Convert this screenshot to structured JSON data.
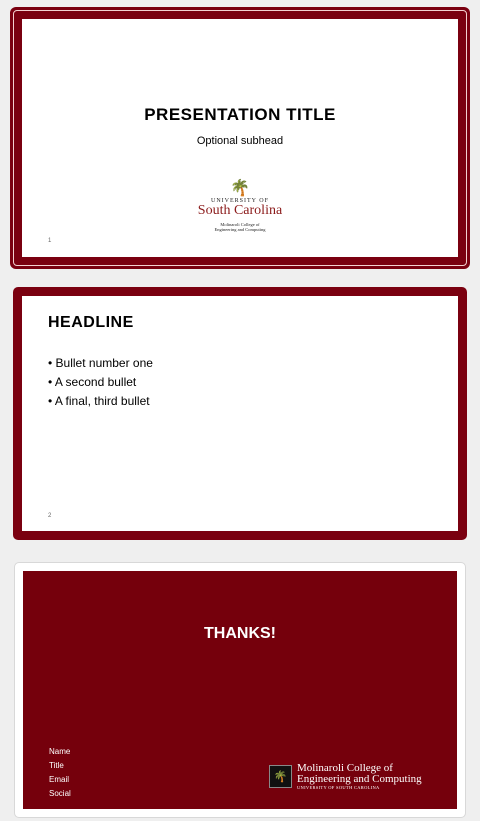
{
  "slides": [
    {
      "number": "1",
      "title": "PRESENTATION TITLE",
      "subhead": "Optional subhead",
      "logo": {
        "line1": "UNIVERSITY OF",
        "line2": "South Carolina",
        "line3": "Molinaroli College of",
        "line4": "Engineering and Computing"
      }
    },
    {
      "number": "2",
      "headline": "HEADLINE",
      "bullets": [
        "Bullet number one",
        "A second bullet",
        "A final, third bullet"
      ]
    },
    {
      "title": "THANKS!",
      "contact": [
        "Name",
        "Title",
        "Email",
        "Social"
      ],
      "logo": {
        "line1": "Molinaroli College of",
        "line2": "Engineering and Computing",
        "line3": "UNIVERSITY OF SOUTH CAROLINA"
      }
    }
  ],
  "colors": {
    "garnet": "#75000c",
    "background": "#efefef"
  }
}
